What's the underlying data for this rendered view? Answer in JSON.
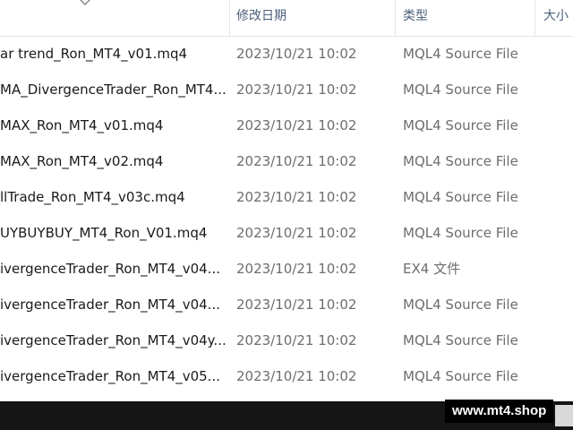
{
  "header": {
    "date_label": "修改日期",
    "type_label": "类型",
    "size_label": "大小"
  },
  "files": [
    {
      "name": "ar trend_Ron_MT4_v01.mq4",
      "date": "2023/10/21 10:02",
      "type": "MQL4 Source File"
    },
    {
      "name": "MA_DivergenceTrader_Ron_MT4...",
      "date": "2023/10/21 10:02",
      "type": "MQL4 Source File"
    },
    {
      "name": "MAX_Ron_MT4_v01.mq4",
      "date": "2023/10/21 10:02",
      "type": "MQL4 Source File"
    },
    {
      "name": "MAX_Ron_MT4_v02.mq4",
      "date": "2023/10/21 10:02",
      "type": "MQL4 Source File"
    },
    {
      "name": "llTrade_Ron_MT4_v03c.mq4",
      "date": "2023/10/21 10:02",
      "type": "MQL4 Source File"
    },
    {
      "name": "UYBUYBUY_MT4_Ron_V01.mq4",
      "date": "2023/10/21 10:02",
      "type": "MQL4 Source File"
    },
    {
      "name": "ivergenceTrader_Ron_MT4_v04...",
      "date": "2023/10/21 10:02",
      "type": "EX4 文件"
    },
    {
      "name": "ivergenceTrader_Ron_MT4_v04...",
      "date": "2023/10/21 10:02",
      "type": "MQL4 Source File"
    },
    {
      "name": "ivergenceTrader_Ron_MT4_v04y...",
      "date": "2023/10/21 10:02",
      "type": "MQL4 Source File"
    },
    {
      "name": "ivergenceTrader_Ron_MT4_v05...",
      "date": "2023/10/21 10:02",
      "type": "MQL4 Source File"
    }
  ],
  "watermark": "www.mt4.shop"
}
